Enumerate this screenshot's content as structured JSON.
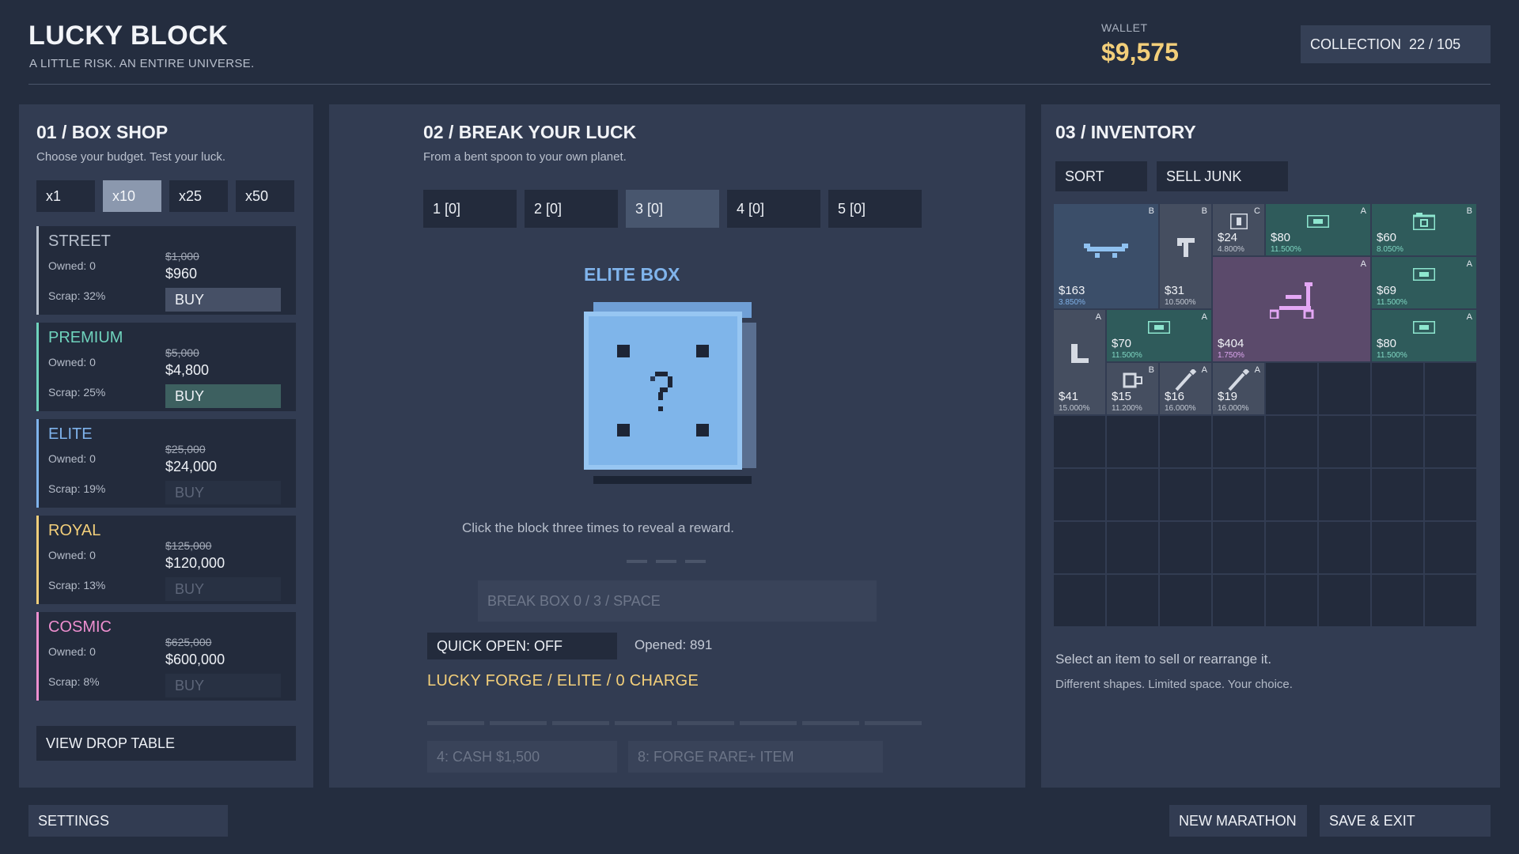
{
  "header": {
    "title": "LUCKY BLOCK",
    "tagline": "A LITTLE RISK. AN ENTIRE UNIVERSE.",
    "wallet_label": "WALLET",
    "wallet_value": "$9,575",
    "collection_label": "COLLECTION",
    "collection_value": "22 / 105"
  },
  "shop": {
    "title": "01 / BOX SHOP",
    "subtitle": "Choose your budget. Test your luck.",
    "multipliers": [
      "x1",
      "x10",
      "x25",
      "x50"
    ],
    "active_multiplier": "x10",
    "boxes": [
      {
        "name": "STREET",
        "owned": "Owned: 0",
        "scrap": "Scrap: 32%",
        "old_price": "$1,000",
        "price": "$960",
        "buy": "BUY",
        "color": "#b7bfcc",
        "affordable": true
      },
      {
        "name": "PREMIUM",
        "owned": "Owned: 0",
        "scrap": "Scrap: 25%",
        "old_price": "$5,000",
        "price": "$4,800",
        "buy": "BUY",
        "color": "#6fd3bd",
        "affordable": true
      },
      {
        "name": "ELITE",
        "owned": "Owned: 0",
        "scrap": "Scrap: 19%",
        "old_price": "$25,000",
        "price": "$24,000",
        "buy": "BUY",
        "color": "#7fb3ec",
        "affordable": false
      },
      {
        "name": "ROYAL",
        "owned": "Owned: 0",
        "scrap": "Scrap: 13%",
        "old_price": "$125,000",
        "price": "$120,000",
        "buy": "BUY",
        "color": "#f3cf7a",
        "affordable": false
      },
      {
        "name": "COSMIC",
        "owned": "Owned: 0",
        "scrap": "Scrap: 8%",
        "old_price": "$625,000",
        "price": "$600,000",
        "buy": "BUY",
        "color": "#ee8fd0",
        "affordable": false
      }
    ],
    "drop_table": "VIEW DROP TABLE"
  },
  "break": {
    "title": "02 / BREAK YOUR LUCK",
    "subtitle": "From a bent spoon to your own planet.",
    "slots": [
      "1  [0]",
      "2  [0]",
      "3  [0]",
      "4  [0]",
      "5  [0]"
    ],
    "active_slot": 2,
    "box_name": "ELITE BOX",
    "hint": "Click the block three times to reveal a reward.",
    "break_button": "BREAK BOX  0 / 3  /  SPACE",
    "clicks": 0,
    "quick_open": "QUICK OPEN: OFF",
    "opened": "Opened: 891",
    "forge": "LUCKY FORGE / ELITE / 0 CHARGE",
    "forge_charge": 0,
    "forge_buttons": [
      "4: CASH $1,500",
      "8: FORGE RARE+ ITEM"
    ]
  },
  "inventory": {
    "title": "03 / INVENTORY",
    "sort": "SORT",
    "sell_junk": "SELL JUNK",
    "items": [
      {
        "price": "$163",
        "pct": "3.850%",
        "grade": "B",
        "kind": "blue",
        "icon": "skateboard-icon"
      },
      {
        "price": "$31",
        "pct": "10.500%",
        "grade": "B",
        "kind": "gray",
        "icon": "hammer-icon"
      },
      {
        "price": "$24",
        "pct": "4.800%",
        "grade": "C",
        "kind": "gray",
        "icon": "frame-icon"
      },
      {
        "price": "$80",
        "pct": "11.500%",
        "grade": "A",
        "kind": "green",
        "icon": "banknote-icon"
      },
      {
        "price": "$60",
        "pct": "8.050%",
        "grade": "B",
        "kind": "green",
        "icon": "camera-icon"
      },
      {
        "price": "$404",
        "pct": "1.750%",
        "grade": "A",
        "kind": "purple",
        "icon": "scooter-icon"
      },
      {
        "price": "$69",
        "pct": "11.500%",
        "grade": "A",
        "kind": "green",
        "icon": "banknote-icon"
      },
      {
        "price": "$41",
        "pct": "15.000%",
        "grade": "A",
        "kind": "gray",
        "icon": "l-bracket-icon"
      },
      {
        "price": "$70",
        "pct": "11.500%",
        "grade": "A",
        "kind": "green",
        "icon": "banknote-icon"
      },
      {
        "price": "$80",
        "pct": "11.500%",
        "grade": "A",
        "kind": "green",
        "icon": "banknote-icon"
      },
      {
        "price": "$15",
        "pct": "11.200%",
        "grade": "B",
        "kind": "gray",
        "icon": "mug-icon"
      },
      {
        "price": "$16",
        "pct": "16.000%",
        "grade": "A",
        "kind": "gray",
        "icon": "spoon-icon"
      },
      {
        "price": "$19",
        "pct": "16.000%",
        "grade": "A",
        "kind": "gray",
        "icon": "spoon-icon"
      }
    ],
    "note1": "Select an item to sell or rearrange it.",
    "note2": "Different shapes. Limited space. Your choice."
  },
  "footer": {
    "settings": "SETTINGS",
    "new_marathon": "NEW MARATHON",
    "save_exit": "SAVE & EXIT"
  }
}
